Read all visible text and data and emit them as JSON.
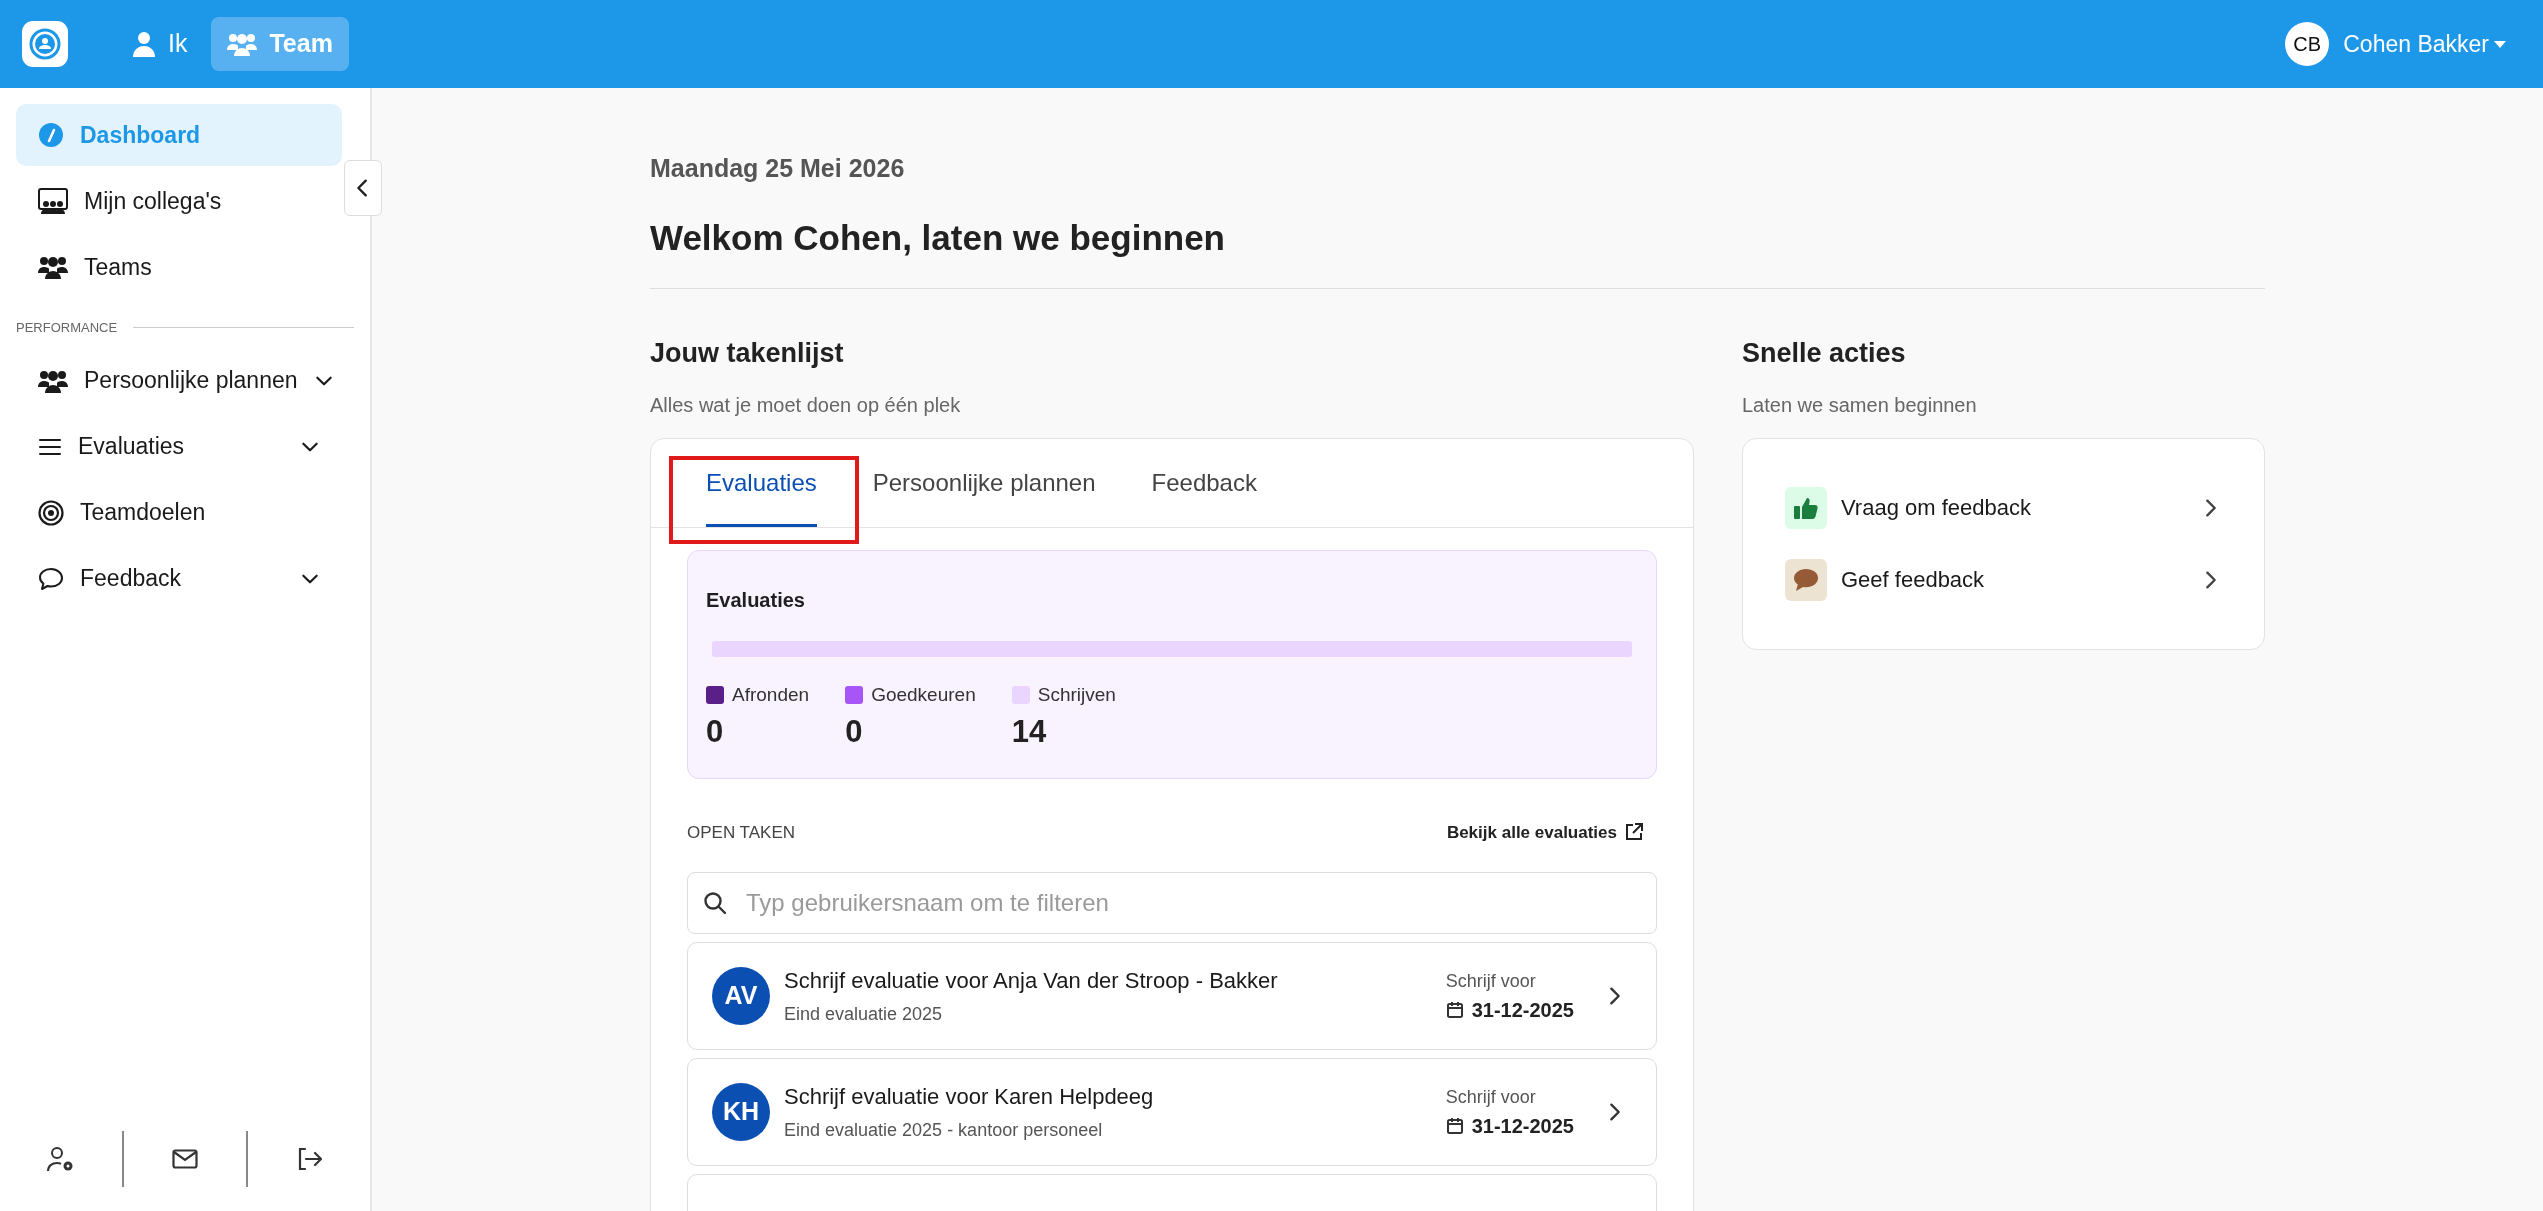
{
  "topbar": {
    "nav": [
      {
        "label": "Ik",
        "selected": false
      },
      {
        "label": "Team",
        "selected": true
      }
    ],
    "user": {
      "initials": "CB",
      "name": "Cohen Bakker"
    }
  },
  "sidebar": {
    "items": [
      {
        "label": "Dashboard",
        "expandable": false,
        "selected": true
      },
      {
        "label": "Mijn collega's",
        "expandable": false,
        "selected": false
      },
      {
        "label": "Teams",
        "expandable": false,
        "selected": false
      }
    ],
    "section_label": "PERFORMANCE",
    "section_items": [
      {
        "label": "Persoonlijke plannen",
        "expandable": true,
        "selected": false
      },
      {
        "label": "Evaluaties",
        "expandable": true,
        "selected": false
      },
      {
        "label": "Teamdoelen",
        "expandable": false,
        "selected": false
      },
      {
        "label": "Feedback",
        "expandable": true,
        "selected": false
      }
    ]
  },
  "date": "Maandag 25 Mei 2026",
  "welcome": "Welkom Cohen, laten we beginnen",
  "tasklist": {
    "title": "Jouw takenlijst",
    "subtitle": "Alles wat je moet doen op één plek",
    "tabs": [
      {
        "label": "Evaluaties",
        "selected": true,
        "highlighted": true
      },
      {
        "label": "Persoonlijke plannen",
        "selected": false,
        "highlighted": false
      },
      {
        "label": "Feedback",
        "selected": false,
        "highlighted": false
      }
    ],
    "summary": {
      "title": "Evaluaties",
      "segments": [
        {
          "label": "Afronden",
          "count": "0",
          "color": "#5b1f8a",
          "level": 0
        },
        {
          "label": "Goedkeuren",
          "count": "0",
          "color": "#a855f7",
          "level": 0
        },
        {
          "label": "Schrijven",
          "count": "14",
          "color": "#e9d5ff",
          "level": 1
        }
      ]
    },
    "open_label": "OPEN TAKEN",
    "view_all": "Bekijk alle evaluaties",
    "search": {
      "placeholder": "Typ gebruikersnaam om te filteren"
    },
    "tasks": [
      {
        "initials": "AV",
        "title": "Schrijf evaluatie voor Anja Van der Stroop - Bakker",
        "subtitle": "Eind evaluatie 2025",
        "due_label": "Schrijf voor",
        "due_date": "31-12-2025"
      },
      {
        "initials": "KH",
        "title": "Schrijf evaluatie voor Karen Helpdeeg",
        "subtitle": "Eind evaluatie 2025 - kantoor personeel",
        "due_label": "Schrijf voor",
        "due_date": "31-12-2025"
      }
    ]
  },
  "quick_actions": {
    "title": "Snelle acties",
    "subtitle": "Laten we samen beginnen",
    "items": [
      {
        "label": "Vraag om feedback"
      },
      {
        "label": "Geef feedback"
      }
    ]
  }
}
